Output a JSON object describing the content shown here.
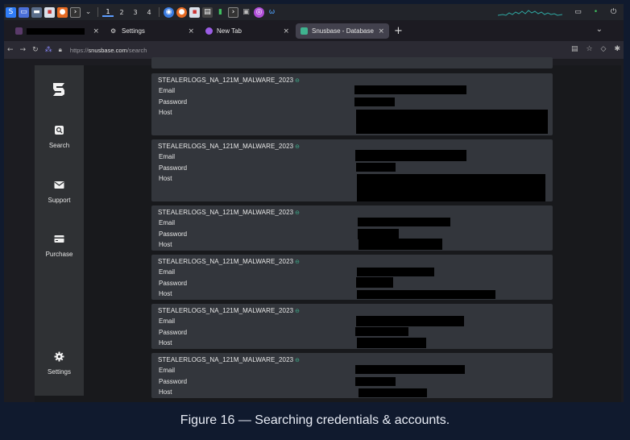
{
  "taskbar": {
    "workspaces": [
      "1",
      "2",
      "3",
      "4"
    ]
  },
  "browser": {
    "tabs": [
      {
        "title": "",
        "redacted": true
      },
      {
        "title": "Settings"
      },
      {
        "title": "New Tab"
      },
      {
        "title": "Snusbase - Database Sear"
      }
    ],
    "url_scheme": "https://",
    "url_host": "snusbase.com",
    "url_path": "/search"
  },
  "sidebar": {
    "items": [
      {
        "label": "Search",
        "icon": "search-icon"
      },
      {
        "label": "Support",
        "icon": "mail-icon"
      },
      {
        "label": "Purchase",
        "icon": "credit-card-icon"
      },
      {
        "label": "Settings",
        "icon": "gear-icon"
      }
    ]
  },
  "results": [
    {
      "title": "STEALERLOGS_NA_121M_MALWARE_2023",
      "fields": [
        "Email",
        "Password",
        "Host"
      ]
    },
    {
      "title": "STEALERLOGS_NA_121M_MALWARE_2023",
      "fields": [
        "Email",
        "Password",
        "Host"
      ]
    },
    {
      "title": "STEALERLOGS_NA_121M_MALWARE_2023",
      "fields": [
        "Email",
        "Password",
        "Host"
      ]
    },
    {
      "title": "STEALERLOGS_NA_121M_MALWARE_2023",
      "fields": [
        "Email",
        "Password",
        "Host"
      ]
    },
    {
      "title": "STEALERLOGS_NA_121M_MALWARE_2023",
      "fields": [
        "Email",
        "Password",
        "Host"
      ]
    },
    {
      "title": "STEALERLOGS_NA_121M_MALWARE_2023",
      "fields": [
        "Email",
        "Password",
        "Host"
      ]
    }
  ],
  "caption": "Figure 16 — Searching credentials & accounts.",
  "colors": {
    "accent_link": "#3fb38f",
    "card_bg": "#33363c",
    "sidebar_bg": "#2f3134",
    "frame_bg": "#101a2e"
  }
}
